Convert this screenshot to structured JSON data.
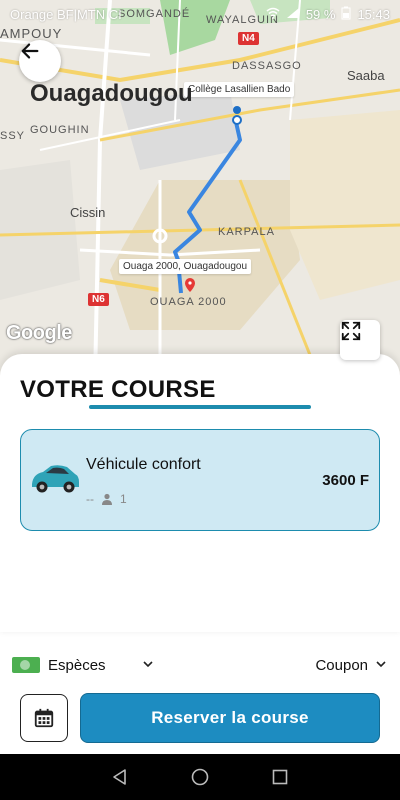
{
  "status_bar": {
    "carrier": "Orange BF|MTN CI",
    "battery": "59 %",
    "time": "15:43"
  },
  "map": {
    "city": "Ouagadougou",
    "labels": {
      "somgande": "SOMGANDÉ",
      "wayalguin": "WAYALGUIN",
      "kampouy": "AMPOUY",
      "dassasgo": "DASSASGO",
      "saaba": "Saaba",
      "goughin": "GOUGHIN",
      "ssy": "SSY",
      "cissin": "Cissin",
      "karpala": "KARPALA",
      "ouaga2000": "OUAGA 2000"
    },
    "road_badges": {
      "n4": "N4",
      "n6": "N6"
    },
    "origin_tag": "Collège Lasallien Bado",
    "destination_tag": "Ouaga 2000, Ouagadougou",
    "google": "Google",
    "route_color": "#3a86e0"
  },
  "sheet": {
    "title": "VOTRE COURSE",
    "vehicle": {
      "name": "Véhicule confort",
      "price": "3600 F",
      "meta_dash": "--",
      "seats": "1"
    }
  },
  "payment": {
    "method": "Espèces",
    "coupon": "Coupon"
  },
  "actions": {
    "book": "Reserver la course"
  },
  "colors": {
    "accent": "#1d8cc1",
    "card_bg": "#cfe9f3"
  }
}
